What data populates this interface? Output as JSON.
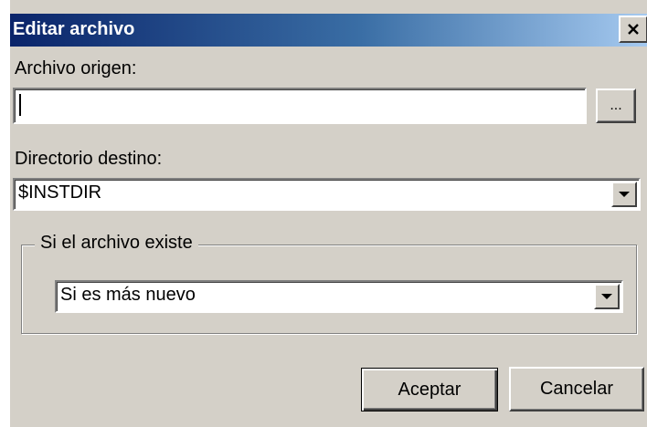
{
  "window": {
    "title": "Editar archivo",
    "close_label": "✕"
  },
  "source_file": {
    "label": "Archivo origen:",
    "value": "",
    "browse_label": "..."
  },
  "dest_dir": {
    "label": "Directorio destino:",
    "value": "$INSTDIR"
  },
  "if_exists": {
    "group_label": "Si el archivo existe",
    "value": "Si es más nuevo"
  },
  "buttons": {
    "ok": "Aceptar",
    "cancel": "Cancelar"
  },
  "colors": {
    "titlebar_start": "#0a246a",
    "titlebar_end": "#a6caf0",
    "face": "#d4d0c8"
  }
}
